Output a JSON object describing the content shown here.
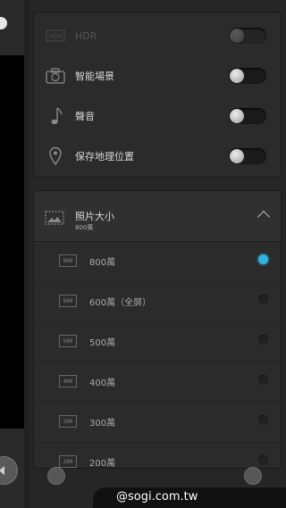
{
  "settings": {
    "hdr_label": "HDR",
    "scene_label": "智能場景",
    "sound_label": "聲音",
    "location_label": "保存地理位置"
  },
  "photo_size": {
    "title": "照片大小",
    "current": "800萬",
    "options": [
      {
        "badge": "800",
        "label": "800萬",
        "selected": true
      },
      {
        "badge": "600",
        "label": "600萬（全屏）",
        "selected": false
      },
      {
        "badge": "500",
        "label": "500萬",
        "selected": false
      },
      {
        "badge": "400",
        "label": "400萬",
        "selected": false
      },
      {
        "badge": "300",
        "label": "300萬",
        "selected": false
      },
      {
        "badge": "200",
        "label": "200萬",
        "selected": false
      }
    ]
  },
  "watermark": "@sogi.com.tw",
  "colors": {
    "accent": "#2fb4e0",
    "background": "#262626"
  }
}
